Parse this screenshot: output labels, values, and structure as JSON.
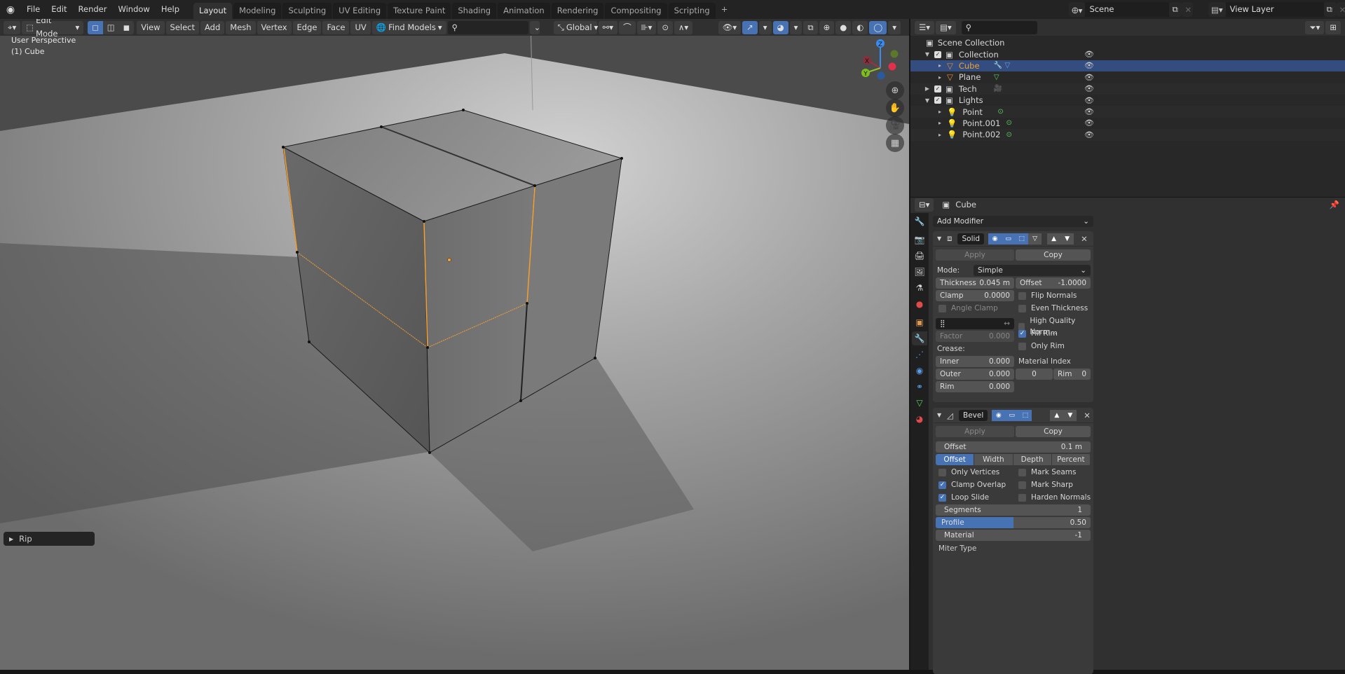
{
  "topbar": {
    "menus": [
      "File",
      "Edit",
      "Render",
      "Window",
      "Help"
    ],
    "workspaces": [
      "Layout",
      "Modeling",
      "Sculpting",
      "UV Editing",
      "Texture Paint",
      "Shading",
      "Animation",
      "Rendering",
      "Compositing",
      "Scripting"
    ],
    "active_workspace": "Layout",
    "add_workspace": "+",
    "scene": "Scene",
    "view_layer": "View Layer"
  },
  "viewport": {
    "mode": "Edit Mode",
    "menus": [
      "View",
      "Select",
      "Add",
      "Mesh",
      "Vertex",
      "Edge",
      "Face",
      "UV"
    ],
    "find_models": "Find Models",
    "transform_orientation": "Global",
    "view_label": "User Perspective",
    "object_label": "(1) Cube",
    "gizmo_axes": {
      "x": "X",
      "y": "Y",
      "z": "Z"
    },
    "last_operator": "Rip"
  },
  "outliner": {
    "root": "Scene Collection",
    "rows": [
      {
        "name": "Collection",
        "type": "collection",
        "expanded": true
      },
      {
        "name": "Cube",
        "type": "mesh",
        "selected": true
      },
      {
        "name": "Plane",
        "type": "mesh"
      },
      {
        "name": "Tech",
        "type": "collection",
        "expanded": false
      },
      {
        "name": "Lights",
        "type": "collection",
        "expanded": true
      },
      {
        "name": "Point",
        "type": "light"
      },
      {
        "name": "Point.001",
        "type": "light"
      },
      {
        "name": "Point.002",
        "type": "light"
      }
    ]
  },
  "properties": {
    "object_name": "Cube",
    "add_modifier": "Add Modifier",
    "solidify": {
      "name": "Solid",
      "apply": "Apply",
      "copy": "Copy",
      "mode_label": "Mode:",
      "mode_value": "Simple",
      "thickness_label": "Thickness",
      "thickness_value": "0.045 m",
      "offset_label": "Offset",
      "offset_value": "-1.0000",
      "clamp_label": "Clamp",
      "clamp_value": "0.0000",
      "angle_clamp": "Angle Clamp",
      "factor_label": "Factor",
      "factor_value": "0.000",
      "crease_label": "Crease:",
      "inner_label": "Inner",
      "inner_value": "0.000",
      "outer_label": "Outer",
      "outer_value": "0.000",
      "rim_label": "Rim",
      "rim_value": "0.000",
      "flip_normals": "Flip Normals",
      "even_thickness": "Even Thickness",
      "high_quality_normals": "High Quality Norm...",
      "fill_rim": "Fill Rim",
      "only_rim": "Only Rim",
      "material_index_offset": "Material Index Offset:",
      "mat_offset_value": "0",
      "mat_rim_label": "Rim",
      "mat_rim_value": "0"
    },
    "bevel": {
      "name": "Bevel",
      "apply": "Apply",
      "copy": "Copy",
      "offset_label": "Offset",
      "offset_value": "0.1 m",
      "width_types": [
        "Offset",
        "Width",
        "Depth",
        "Percent"
      ],
      "width_type_selected": "Offset",
      "only_vertices": "Only Vertices",
      "clamp_overlap": "Clamp Overlap",
      "loop_slide": "Loop Slide",
      "mark_seams": "Mark Seams",
      "mark_sharp": "Mark Sharp",
      "harden_normals": "Harden Normals",
      "segments_label": "Segments",
      "segments_value": "1",
      "profile_label": "Profile",
      "profile_value": "0.50",
      "profile_fraction": 0.5,
      "material_label": "Material",
      "material_value": "-1",
      "next_label": "Miter Type"
    }
  },
  "colors": {
    "accent": "#4772b3",
    "selection_orange": "#f5a030",
    "selected_row": "#334d80"
  }
}
